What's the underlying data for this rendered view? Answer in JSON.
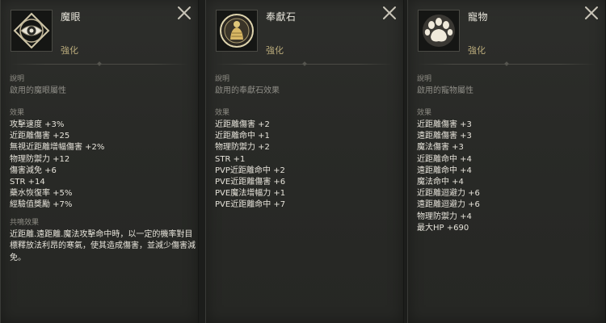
{
  "panels": [
    {
      "icon": "eye-icon",
      "name": "魔眼",
      "grade": "強化",
      "desc_title": "說明",
      "desc_text": "啟用的魔眼屬性",
      "effects_title": "效果",
      "effects": [
        "攻擊速度 +3%",
        "近距離傷害 +25",
        "無視近距離增幅傷害 +2%",
        "物理防禦力 +12",
        "傷害減免 +6",
        "STR +14",
        "藥水恢復率 +5%",
        "經驗值獎勵 +7%"
      ],
      "resonance_title": "共鳴效果",
      "resonance_text": "近距離.遠距離.魔法攻擊命中時，以一定的機率對目標釋放法利昂的寒氣，使其造成傷害，並減少傷害減免。"
    },
    {
      "icon": "tribute-stone-icon",
      "name": "奉獻石",
      "grade": "強化",
      "desc_title": "說明",
      "desc_text": "啟用的奉獻石效果",
      "effects_title": "效果",
      "effects": [
        "近距離傷害 +2",
        "近距離命中 +1",
        "物理防禦力 +2",
        "STR +1",
        "PVP近距離命中 +2",
        "PVE近距離傷害 +6",
        "PVE魔法增幅力 +1",
        "PVE近距離命中 +7"
      ]
    },
    {
      "icon": "paw-icon",
      "name": "寵物",
      "grade": "強化",
      "desc_title": "說明",
      "desc_text": "啟用的寵物屬性",
      "effects_title": "效果",
      "effects": [
        "近距離傷害 +3",
        "遠距離傷害 +3",
        "魔法傷害 +3",
        "近距離命中 +4",
        "遠距離命中 +4",
        "魔法命中 +4",
        "近距離迴避力 +6",
        "遠距離迴避力 +6",
        "物理防禦力 +4",
        "最大HP +690"
      ]
    }
  ],
  "colors": {
    "panel_bg": "#2b2c29",
    "title_text": "#e9e6dc",
    "grade_text": "#b8a97a",
    "muted_text": "#8f8e87",
    "effect_text": "#e6e3da",
    "close_icon": "#c9c5b8"
  }
}
